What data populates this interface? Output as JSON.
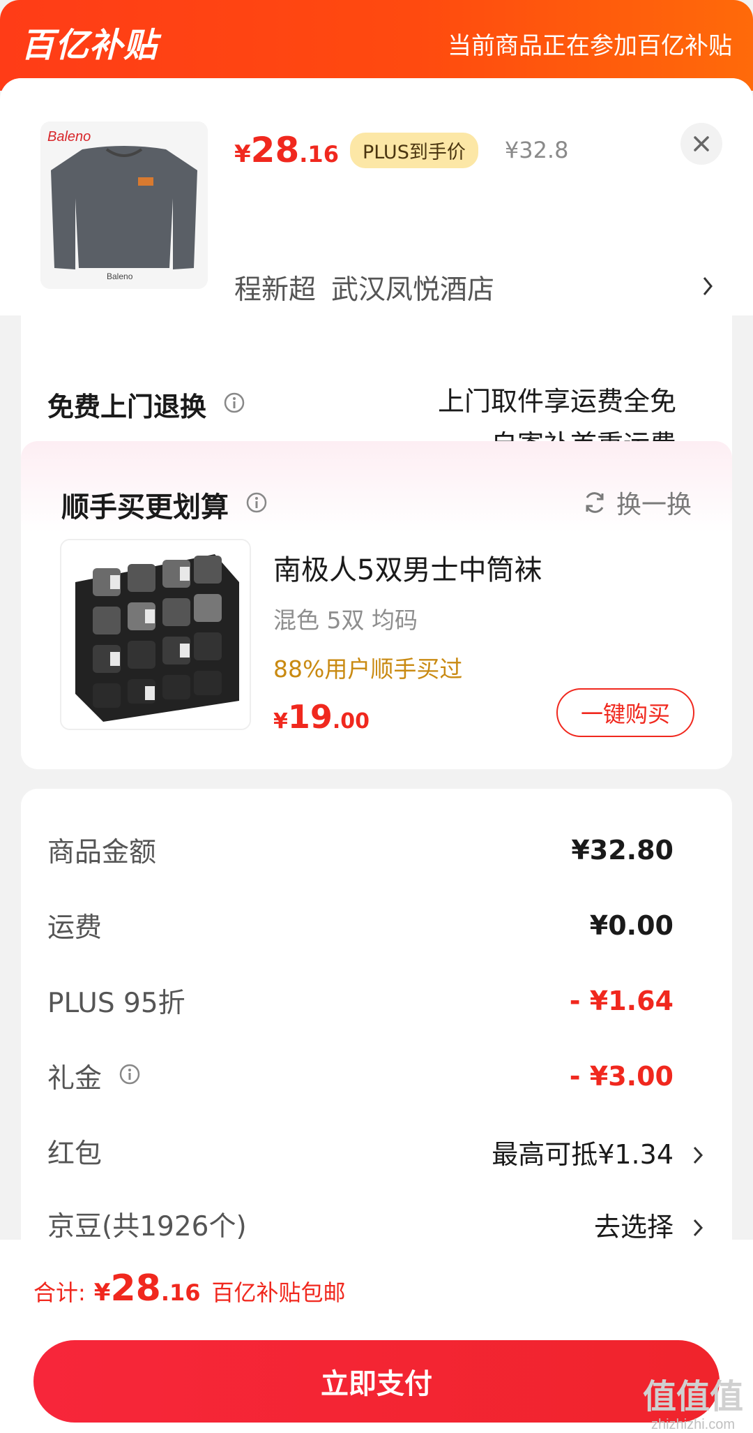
{
  "banner": {
    "logo": "百亿补贴",
    "note": "当前商品正在参加百亿补贴"
  },
  "product": {
    "image_name": "Baleno sweatshirt",
    "price_symbol": "¥",
    "price_int": "28",
    "price_dec": ".16",
    "plus_tag": "PLUS到手价",
    "original_price": "¥32.8",
    "address_name": "程新超",
    "address": "武汉凤悦酒店"
  },
  "returns": {
    "title": "免费上门退换",
    "line1": "上门取件享运费全免",
    "line2": "自寄补首重运费"
  },
  "upsell": {
    "title": "顺手买更划算",
    "swap_label": "换一换",
    "item_name": "南极人5双男士中筒袜",
    "item_spec": "混色 5双   均码",
    "item_pct": "88%用户顺手买过",
    "price_symbol": "¥",
    "price_int": "19",
    "price_dec": ".00",
    "buy_label": "一键购买"
  },
  "summary": {
    "rows": [
      {
        "label": "商品金额",
        "value": "¥32.80"
      },
      {
        "label": "运费",
        "value": "¥0.00"
      },
      {
        "label": "PLUS 95折",
        "value": "- ¥1.64"
      },
      {
        "label": "礼金",
        "value": "- ¥3.00"
      },
      {
        "label": "红包",
        "value": "最高可抵¥1.34"
      },
      {
        "label": "京豆(共1926个)",
        "value": "去选择"
      }
    ]
  },
  "footer": {
    "total_label": "合计:",
    "total_symbol": "¥",
    "total_int": "28",
    "total_dec": ".16",
    "total_note": "百亿补贴包邮",
    "pay_label": "立即支付"
  },
  "watermark": {
    "big": "值值值",
    "small": "zhizhizhi.com"
  },
  "colors": {
    "accent": "#f0281e",
    "banner": "#ff4a0f",
    "plus_tag": "#fce7a6",
    "pct_gold": "#c98a12"
  }
}
